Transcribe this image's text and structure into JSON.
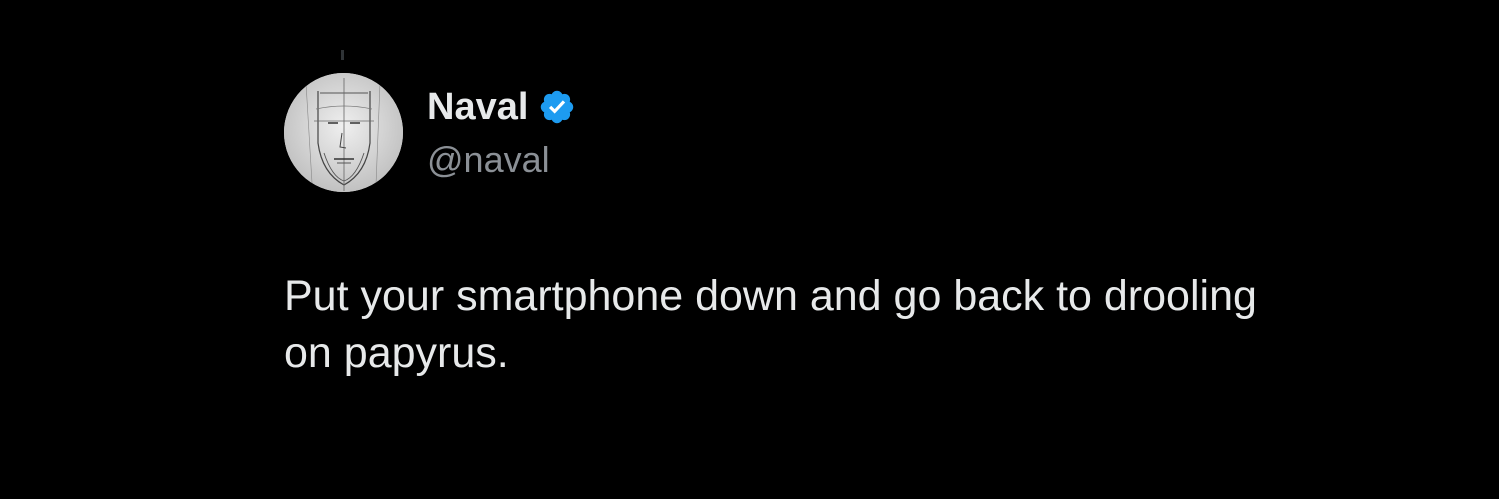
{
  "author": {
    "display_name": "Naval",
    "handle": "@naval",
    "verified": true,
    "verified_icon": "verified-badge-icon",
    "verified_color": "#1d9bf0",
    "avatar_icon": "sketched-face-avatar"
  },
  "tweet": {
    "text": "Put your smartphone down and go back to drooling on papyrus."
  },
  "colors": {
    "background": "#000000",
    "primary_text": "#e7e9ea",
    "secondary_text": "#8b9096"
  }
}
